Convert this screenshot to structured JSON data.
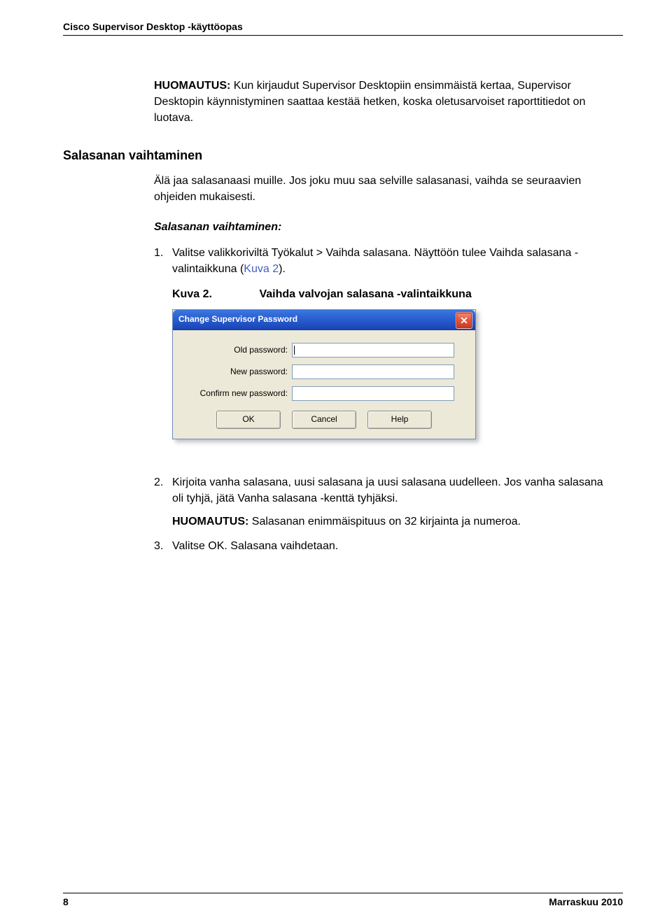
{
  "header": {
    "title": "Cisco Supervisor Desktop -käyttöopas"
  },
  "note": {
    "label": "HUOMAUTUS:",
    "text": "Kun kirjaudut Supervisor Desktopiin ensimmäistä kertaa, Supervisor Desktopin käynnistyminen saattaa kestää hetken, koska oletusarvoiset raporttitiedot on luotava."
  },
  "section": {
    "title": "Salasanan vaihtaminen",
    "intro": "Älä jaa salasanaasi muille. Jos joku muu saa selville salasanasi, vaihda se seuraavien ohjeiden mukaisesti."
  },
  "procedure": {
    "heading": "Salasanan vaihtaminen:",
    "step1_num": "1.",
    "step1_text_a": "Valitse valikkoriviltä Työkalut > Vaihda salasana. Näyttöön tulee Vaihda salasana -valintaikkuna (",
    "step1_ref": "Kuva 2",
    "step1_text_b": ").",
    "figure": {
      "label": "Kuva 2.",
      "caption": "Vaihda valvojan salasana -valintaikkuna"
    },
    "step2_num": "2.",
    "step2_text": "Kirjoita vanha salasana, uusi salasana ja uusi salasana uudelleen. Jos vanha salasana oli tyhjä, jätä Vanha salasana -kenttä tyhjäksi.",
    "step2_note_label": "HUOMAUTUS:",
    "step2_note_text": "Salasanan enimmäispituus on 32 kirjainta ja numeroa.",
    "step3_num": "3.",
    "step3_text": "Valitse OK. Salasana vaihdetaan."
  },
  "dialog": {
    "title": "Change Supervisor Password",
    "fields": {
      "old_label": "Old password:",
      "new_label": "New password:",
      "confirm_label": "Confirm new password:"
    },
    "buttons": {
      "ok": "OK",
      "cancel": "Cancel",
      "help": "Help"
    }
  },
  "footer": {
    "page": "8",
    "date": "Marraskuu 2010"
  }
}
